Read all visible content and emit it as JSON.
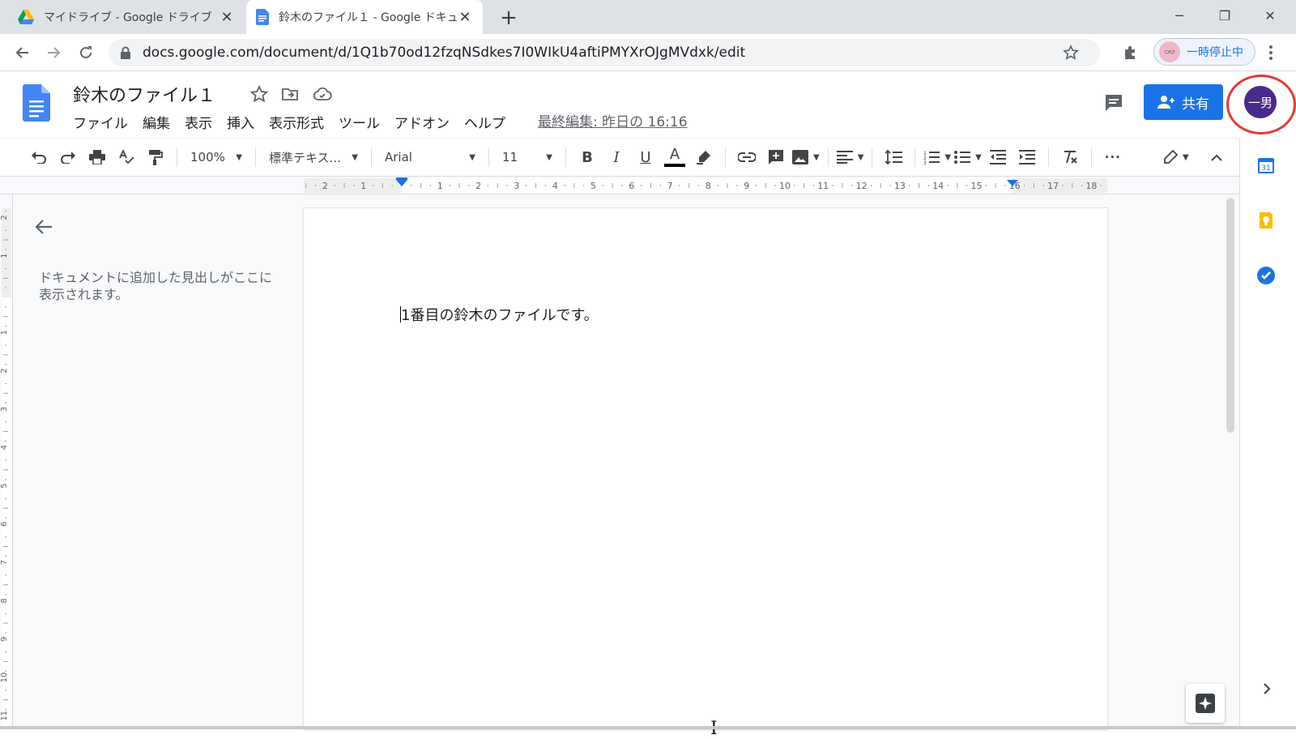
{
  "browser": {
    "tabs": [
      {
        "title": "マイドライブ - Google ドライブ",
        "icon": "google-drive-icon",
        "active": false
      },
      {
        "title": "鈴木のファイル１ - Google ドキュメント",
        "icon": "google-docs-icon",
        "active": true
      }
    ],
    "url": "docs.google.com/document/d/1Q1b70od12fzqNSdkes7I0WIkU4aftiPMYXrOJgMVdxk/edit",
    "profile_status": "一時停止中",
    "colors": {
      "tabbar": "#dee1e6",
      "accent": "#1a73e8"
    }
  },
  "docs": {
    "title": "鈴木のファイル１",
    "menu": [
      "ファイル",
      "編集",
      "表示",
      "挿入",
      "表示形式",
      "ツール",
      "アドオン",
      "ヘルプ"
    ],
    "last_edit": "最終編集: 昨日の 16:16",
    "share_label": "共有",
    "avatar_text": "一男",
    "avatar_color": "#4a2a8c",
    "highlight_color": "#e53935"
  },
  "toolbar": {
    "zoom": "100%",
    "style": "標準テキス...",
    "font": "Arial",
    "font_size": "11",
    "bold": "B",
    "italic": "I",
    "underline": "U",
    "text_color": "A",
    "more": "···"
  },
  "ruler": {
    "labels": [
      "2",
      "1",
      "1",
      "2",
      "3",
      "4",
      "5",
      "6",
      "7",
      "8",
      "9",
      "10",
      "11",
      "12",
      "13",
      "14",
      "15",
      "16",
      "17",
      "18"
    ],
    "vertical_labels": [
      "2",
      "1",
      "1",
      "2",
      "3",
      "4",
      "5",
      "6",
      "7",
      "8",
      "9",
      "10",
      "11"
    ]
  },
  "outline": {
    "hint": "ドキュメントに追加した見出しがここに表示されます。"
  },
  "document": {
    "body": "1番目の鈴木のファイルです。"
  }
}
